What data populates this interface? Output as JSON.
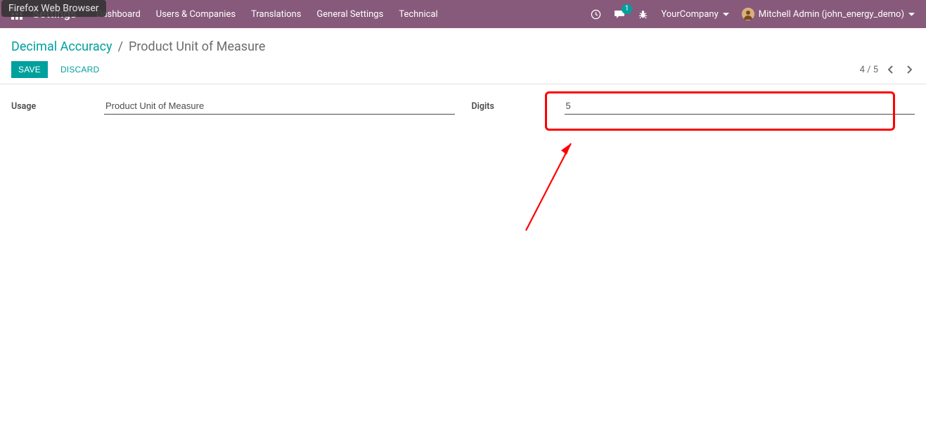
{
  "browser_tag": "Firefox Web Browser",
  "topbar": {
    "app_title": "Settings",
    "menu": [
      "Dashboard",
      "Users & Companies",
      "Translations",
      "General Settings",
      "Technical"
    ],
    "messages_badge": "1",
    "company": "YourCompany",
    "user": "Mitchell Admin (john_energy_demo)"
  },
  "breadcrumb": {
    "parent": "Decimal Accuracy",
    "sep": "/",
    "current": "Product Unit of Measure"
  },
  "buttons": {
    "save": "SAVE",
    "discard": "DISCARD"
  },
  "pager": {
    "text": "4 / 5"
  },
  "form": {
    "usage_label": "Usage",
    "usage_value": "Product Unit of Measure",
    "digits_label": "Digits",
    "digits_value": "5"
  }
}
